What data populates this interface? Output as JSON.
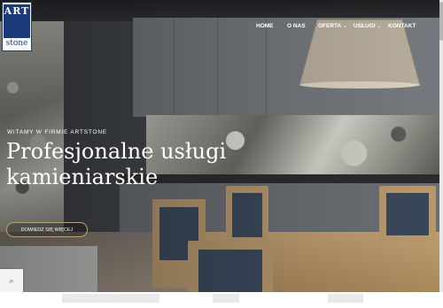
{
  "logo": {
    "line1": "ART",
    "line2": "stone"
  },
  "nav": [
    {
      "label": "HOME",
      "dropdown": false
    },
    {
      "label": "O NAS",
      "dropdown": false
    },
    {
      "label": "OFERTA",
      "dropdown": true
    },
    {
      "label": "USŁUGI",
      "dropdown": true
    },
    {
      "label": "KONTAKT",
      "dropdown": false
    }
  ],
  "hero": {
    "kicker": "WITAMY W FIRMIE ARTSTONE",
    "headline": "Profesjonalne usługi kamieniarskie",
    "cta": "DOWIEDZ SIĘ WIĘCEJ"
  },
  "icons": {
    "caret": "chevron-down-icon",
    "side": "search-icon"
  },
  "colors": {
    "accent": "#c9a25a",
    "brand": "#1b3a7a"
  }
}
